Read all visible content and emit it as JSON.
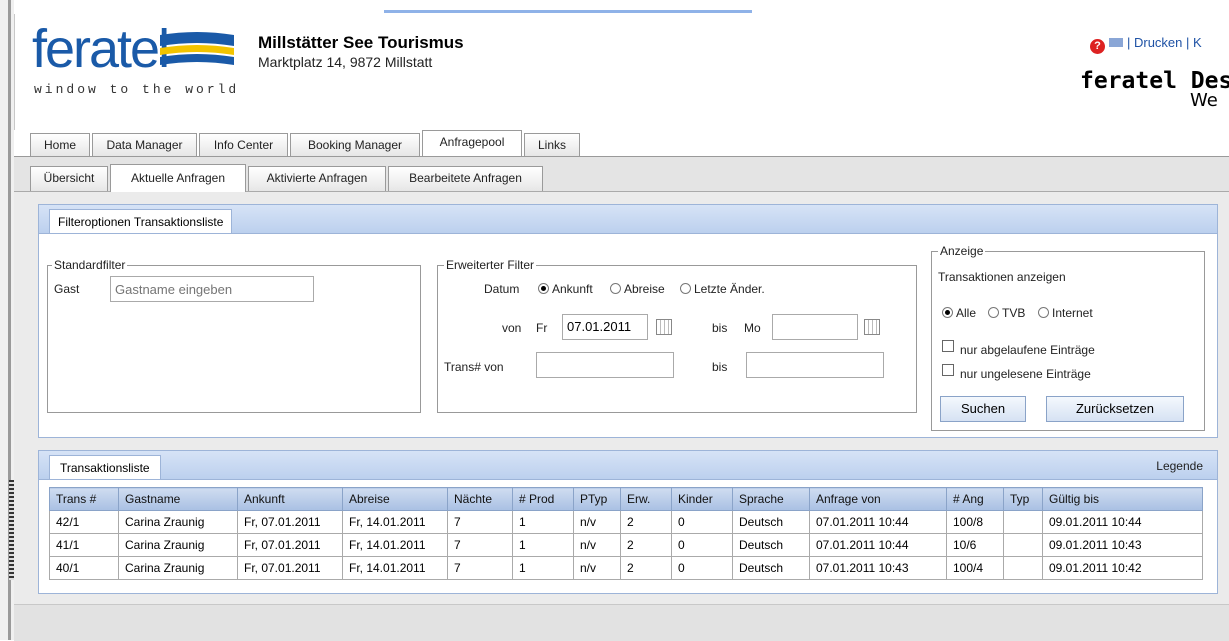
{
  "header": {
    "logo_text": "feratel",
    "logo_tagline": "window to the world",
    "org_name": "Millstätter See Tourismus",
    "org_address": "Marktplatz 14, 9872 Millstatt",
    "links": "| Drucken | K",
    "brand_right": "feratel Des",
    "brand_right_line2": "We"
  },
  "main_tabs": [
    {
      "label": "Home"
    },
    {
      "label": "Data Manager"
    },
    {
      "label": "Info Center"
    },
    {
      "label": "Booking Manager"
    },
    {
      "label": "Anfragepool",
      "active": true
    },
    {
      "label": "Links"
    }
  ],
  "sub_tabs": [
    {
      "label": "Übersicht"
    },
    {
      "label": "Aktuelle Anfragen",
      "active": true
    },
    {
      "label": "Aktivierte Anfragen"
    },
    {
      "label": "Bearbeitete Anfragen"
    }
  ],
  "filter": {
    "panel_title": "Filteroptionen Transaktionsliste",
    "standard": {
      "legend": "Standardfilter",
      "guest_label": "Gast",
      "guest_placeholder": "Gastname eingeben"
    },
    "extended": {
      "legend": "Erweiterter Filter",
      "date_label": "Datum",
      "date_options": [
        "Ankunft",
        "Abreise",
        "Letzte Änder."
      ],
      "from_label": "von",
      "from_day": "Fr",
      "from_value": "07.01.2011",
      "to_label": "bis",
      "to_day": "Mo",
      "to_value": "",
      "trans_from_label": "Trans# von",
      "trans_to_label": "bis"
    },
    "display": {
      "legend": "Anzeige",
      "show_label": "Transaktionen anzeigen",
      "options": [
        "Alle",
        "TVB",
        "Internet"
      ],
      "check_expired": "nur abgelaufene Einträge",
      "check_unread": "nur ungelesene Einträge",
      "search_button": "Suchen",
      "reset_button": "Zurücksetzen"
    }
  },
  "list": {
    "panel_title": "Transaktionsliste",
    "legend_link": "Legende",
    "columns": [
      "Trans #",
      "Gastname",
      "Ankunft",
      "Abreise",
      "Nächte",
      "# Prod",
      "PTyp",
      "Erw.",
      "Kinder",
      "Sprache",
      "Anfrage von",
      "# Ang",
      "Typ",
      "Gültig bis"
    ],
    "rows": [
      [
        "42/1",
        "Carina Zraunig",
        "Fr,  07.01.2011",
        "Fr,  14.01.2011",
        "7",
        "1",
        "n/v",
        "2",
        "0",
        "Deutsch",
        "07.01.2011 10:44",
        "100/8",
        "",
        "09.01.2011 10:44"
      ],
      [
        "41/1",
        "Carina Zraunig",
        "Fr,  07.01.2011",
        "Fr,  14.01.2011",
        "7",
        "1",
        "n/v",
        "2",
        "0",
        "Deutsch",
        "07.01.2011 10:44",
        "10/6",
        "",
        "09.01.2011 10:43"
      ],
      [
        "40/1",
        "Carina Zraunig",
        "Fr,  07.01.2011",
        "Fr,  14.01.2011",
        "7",
        "1",
        "n/v",
        "2",
        "0",
        "Deutsch",
        "07.01.2011 10:43",
        "100/4",
        "",
        "09.01.2011 10:42"
      ]
    ]
  }
}
